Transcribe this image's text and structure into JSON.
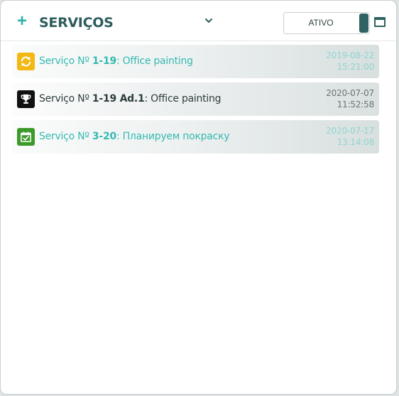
{
  "header": {
    "add_label": "+",
    "title": "SERVIÇOS",
    "toggle_label": "ATIVO"
  },
  "items": [
    {
      "icon": "refresh-icon",
      "icon_color": "#f3b814",
      "prefix": "Serviço Nº ",
      "number": "1-19",
      "separator": ":  ",
      "name": "Office painting",
      "date": "2019-08-22",
      "time": "15:21:00",
      "style": "teal"
    },
    {
      "icon": "trophy-icon",
      "icon_color": "#111111",
      "prefix": "Serviço Nº ",
      "number": "1-19 Ad.1",
      "separator": ":  ",
      "name": "Office painting",
      "date": "2020-07-07",
      "time": "11:52:58",
      "style": "dark"
    },
    {
      "icon": "calendar-check-icon",
      "icon_color": "#3c9a2a",
      "prefix": "Serviço Nº ",
      "number": "3-20",
      "separator": ":  ",
      "name": "Планируем покраску",
      "date": "2020-07-17",
      "time": "13:14:08",
      "style": "teal"
    }
  ]
}
